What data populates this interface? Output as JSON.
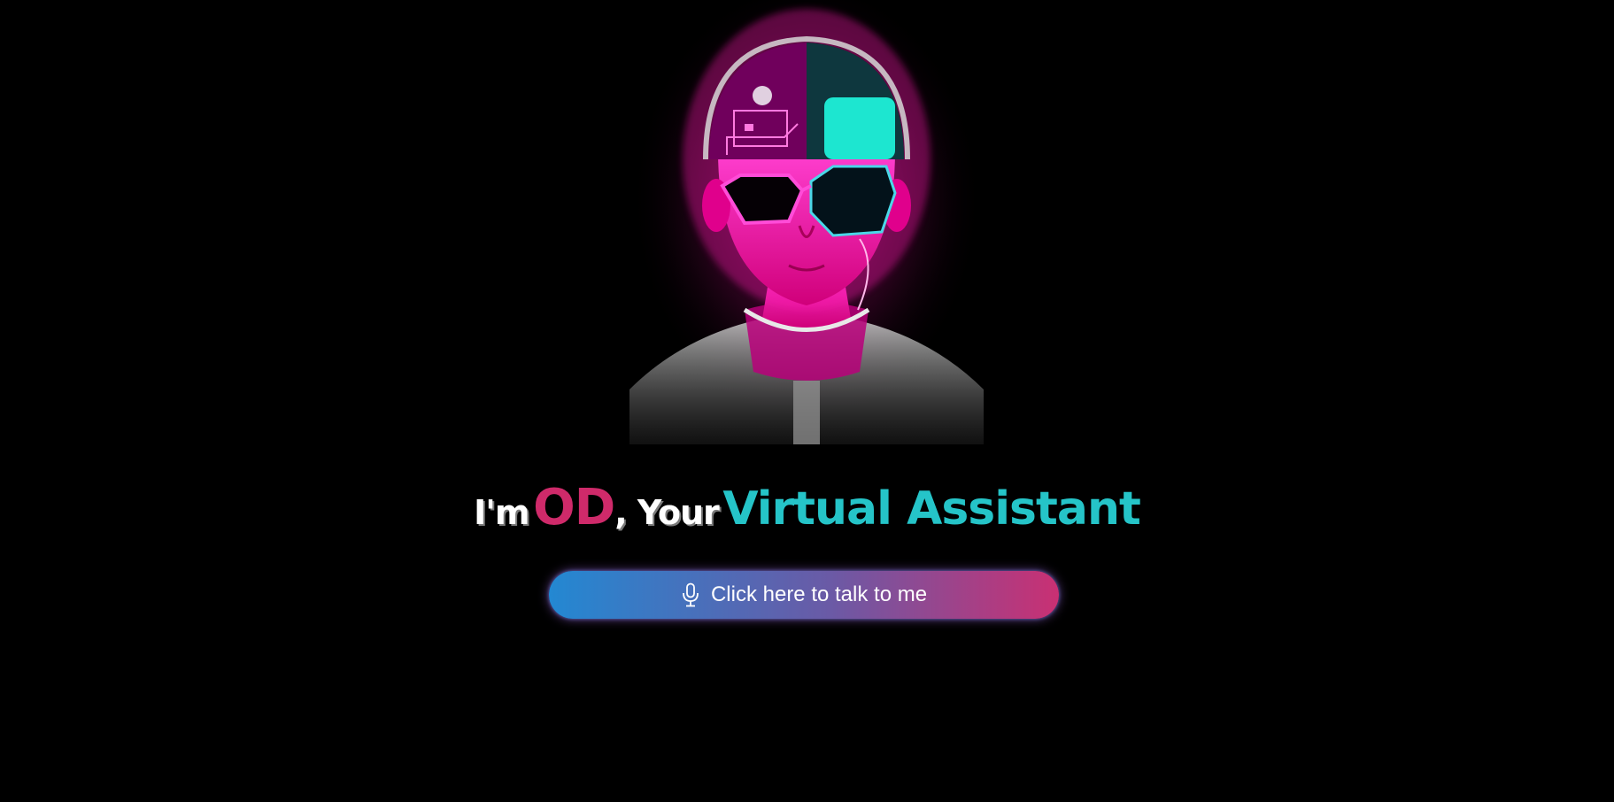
{
  "headline": {
    "prefix": "I'm",
    "name": "OD",
    "middle": ", Your",
    "highlight": "Virtual Assistant"
  },
  "talk_button": {
    "label": "Click here to talk to me",
    "icon": "microphone-icon"
  },
  "avatar": {
    "icon": "neon-cyberpunk-avatar"
  },
  "colors": {
    "background": "#000000",
    "name_accent": "#cf2a6a",
    "highlight_accent": "#25c4c8",
    "button_gradient_start": "#2388d2",
    "button_gradient_end": "#c93073",
    "neon_pink": "#ff1aa8",
    "neon_teal": "#1de6d0"
  }
}
